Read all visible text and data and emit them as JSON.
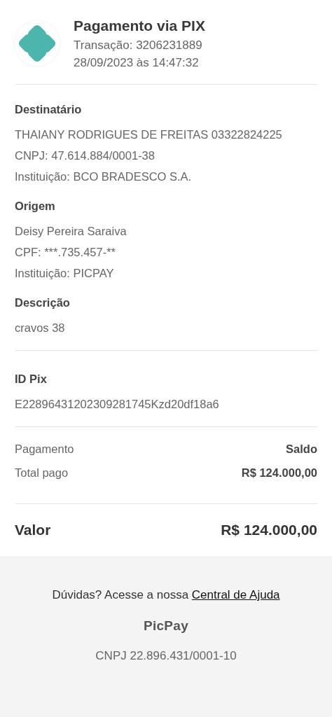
{
  "header": {
    "title": "Pagamento via PIX",
    "transaction": "Transação: 3206231889",
    "datetime": "28/09/2023 às 14:47:32"
  },
  "sections": [
    {
      "title": "Destinatário",
      "lines": [
        "THAIANY RODRIGUES DE FREITAS 03322824225",
        "CNPJ: 47.614.884/0001-38",
        "Instituição: BCO BRADESCO S.A."
      ]
    },
    {
      "title": "Origem",
      "lines": [
        "Deisy Pereira Saraiva",
        "CPF: ***.735.457-**",
        "Instituição: PICPAY"
      ]
    },
    {
      "title": "Descrição",
      "lines": [
        "cravos 38"
      ]
    }
  ],
  "pix_id": {
    "title": "ID Pix",
    "value": "E22896431202309281745Kzd20df18a6"
  },
  "payment_rows": [
    {
      "label": "Pagamento",
      "value": "Saldo"
    },
    {
      "label": "Total pago",
      "value": "R$ 124.000,00"
    }
  ],
  "total": {
    "label": "Valor",
    "value": "R$ 124.000,00"
  },
  "footer": {
    "help_text": "Dúvidas? Acesse a nossa",
    "help_link": "Central de Ajuda",
    "brand": "PicPay",
    "company_id": "CNPJ 22.896.431/0001-10"
  }
}
